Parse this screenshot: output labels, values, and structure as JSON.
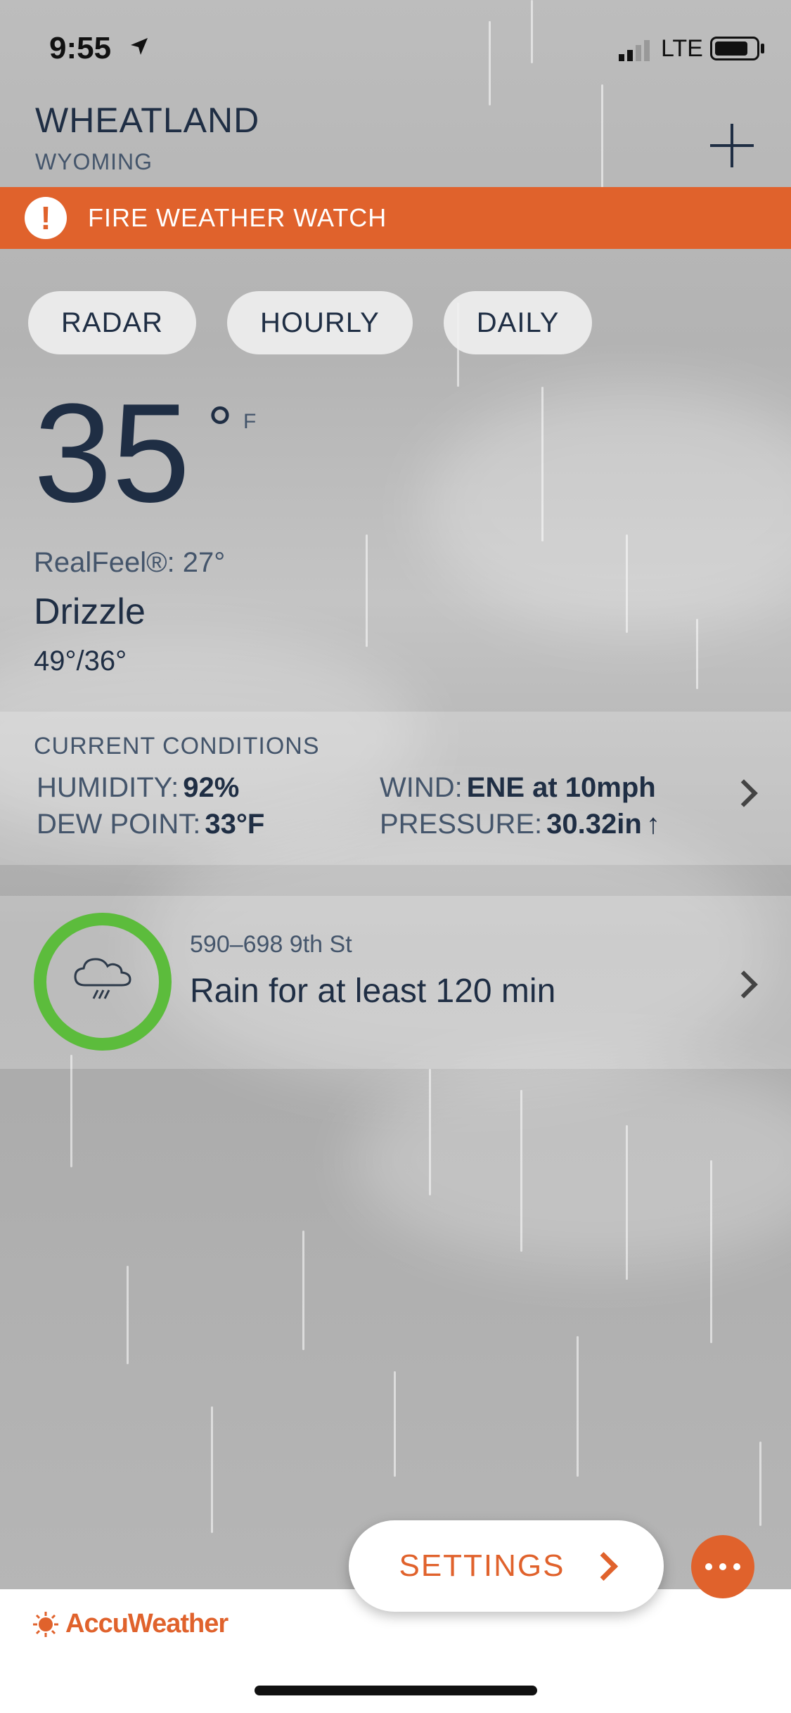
{
  "status": {
    "time": "9:55",
    "network": "LTE"
  },
  "header": {
    "city": "WHEATLAND",
    "state": "WYOMING"
  },
  "alert": {
    "text": "FIRE WEATHER WATCH"
  },
  "tabs": [
    {
      "label": "RADAR"
    },
    {
      "label": "HOURLY"
    },
    {
      "label": "DAILY"
    }
  ],
  "current": {
    "temp": "35",
    "unit": "F",
    "realfeel": "RealFeel®: 27°",
    "condition": "Drizzle",
    "hilo": "49°/36°"
  },
  "conditions": {
    "title": "CURRENT CONDITIONS",
    "humidity_label": "HUMIDITY:",
    "humidity_value": "92%",
    "dewpoint_label": "DEW POINT:",
    "dewpoint_value": "33°F",
    "wind_label": "WIND:",
    "wind_value": "ENE at 10mph",
    "pressure_label": "PRESSURE:",
    "pressure_value": "30.32in"
  },
  "minutecast": {
    "address": "590–698 9th St",
    "text": "Rain for at least 120 min"
  },
  "bottom": {
    "settings_label": "SETTINGS",
    "logo_text": "AccuWeather"
  },
  "colors": {
    "accent": "#e0622c",
    "ring": "#5cbc3c",
    "text": "#1f2e44"
  }
}
